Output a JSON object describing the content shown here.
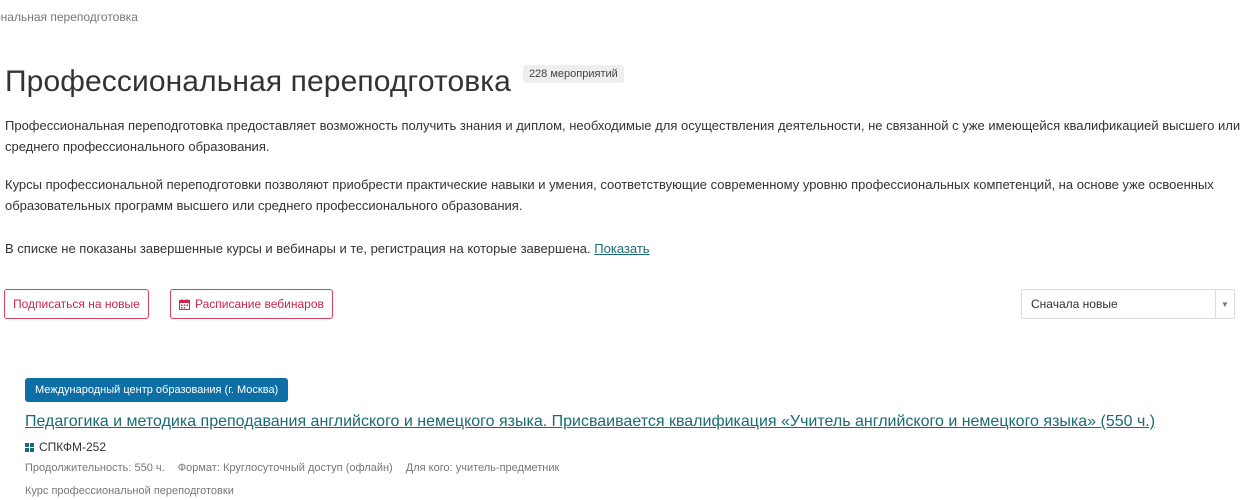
{
  "breadcrumb": "ональная переподготовка",
  "page": {
    "title": "Профессиональная переподготовка",
    "count_badge": "228 мероприятий"
  },
  "description": {
    "p1": "Профессиональная переподготовка предоставляет возможность получить знания и диплом, необходимые для осуществления деятельности, не связанной с уже имеющейся квалификацией высшего или среднего профессионального образования.",
    "p2": "Курсы профессиональной переподготовки позволяют приобрести практические навыки и умения, соответствующие современному уровню профессиональных компетенций, на основе уже освоенных образовательных программ высшего или среднего профессионального образования.",
    "p3_text": "В списке не показаны завершенные курсы и вебинары и те, регистрация на которые завершена.",
    "p3_link": "Показать"
  },
  "actions": {
    "subscribe_label": "Подписаться на новые",
    "schedule_label": "Расписание вебинаров",
    "sort_value": "Сначала новые"
  },
  "course": {
    "org_badge": "Международный центр образования (г. Москва)",
    "title": "Педагогика и методика преподавания английского и немецкого языка. Присваивается квалификация «Учитель английского и немецкого языка» (550 ч.)",
    "code": "СПКФМ-252",
    "duration": "Продолжительность: 550 ч.",
    "format": "Формат: Круглосуточный доступ (офлайн)",
    "audience": "Для кого: учитель-предметник",
    "type": "Курс профессиональной переподготовки"
  },
  "colors": {
    "accent_red": "#c8274a",
    "link_teal": "#1a6b73",
    "badge_blue": "#0e6fa6"
  },
  "icons": {
    "calendar": "calendar-icon",
    "code": "grid-icon",
    "dropdown": "chevron-down-icon"
  }
}
